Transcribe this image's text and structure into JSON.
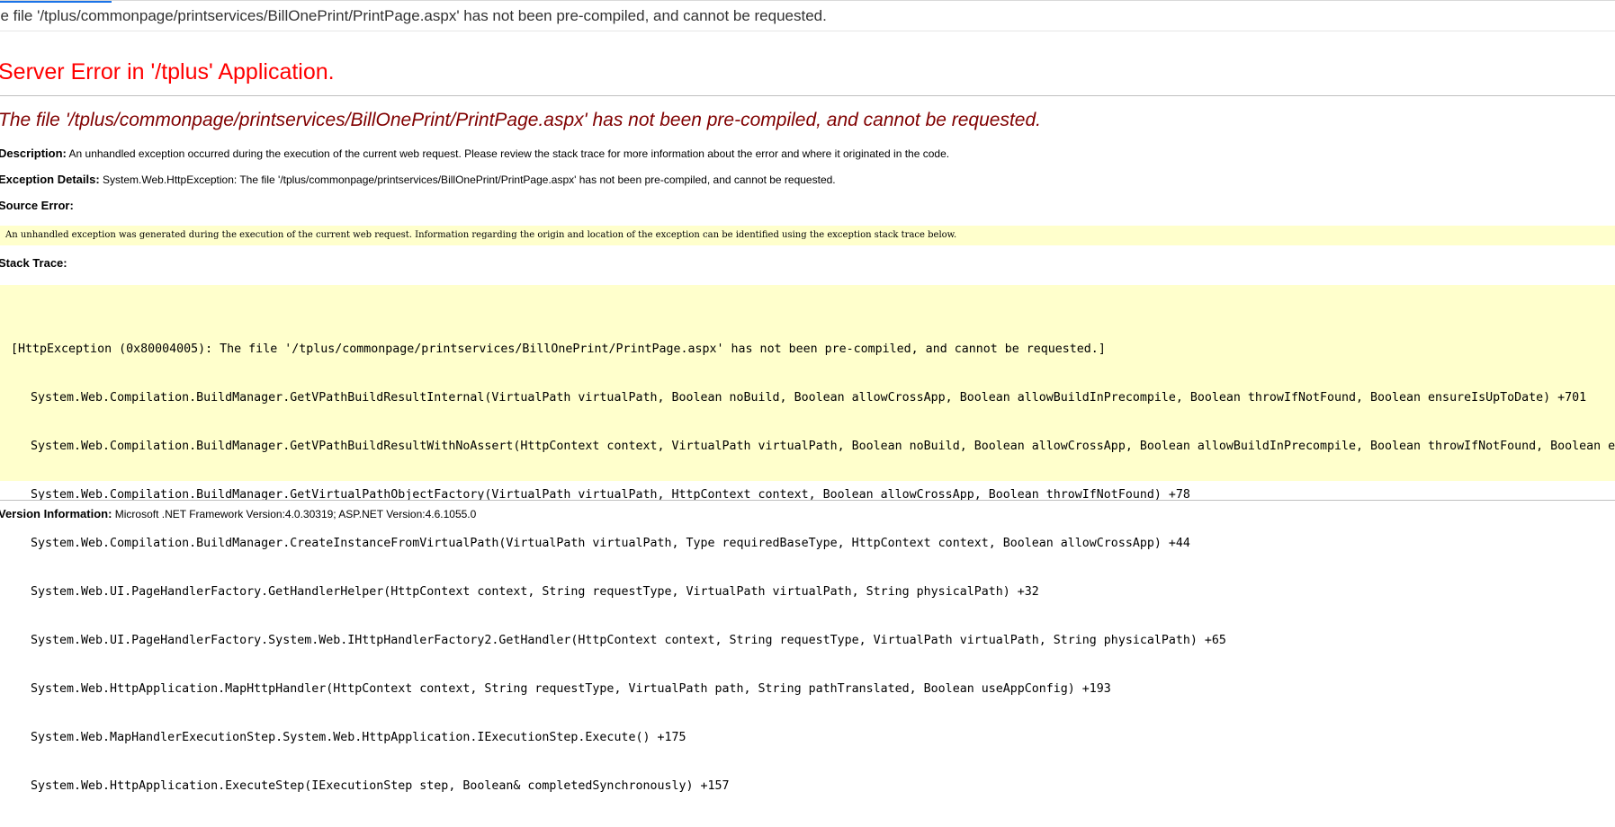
{
  "browser_tab": {
    "title": "he file '/tplus/commonpage/printservices/BillOnePrint/PrintPage.aspx' has not been pre-compiled, and cannot be requested."
  },
  "page": {
    "server_error_title": "Server Error in '/tplus' Application.",
    "error_heading": "The file '/tplus/commonpage/printservices/BillOnePrint/PrintPage.aspx' has not been pre-compiled, and cannot be requested.",
    "description_label": "Description:",
    "description_text": "An unhandled exception occurred during the execution of the current web request. Please review the stack trace for more information about the error and where it originated in the code.",
    "exception_label": "Exception Details:",
    "exception_text": "System.Web.HttpException: The file '/tplus/commonpage/printservices/BillOnePrint/PrintPage.aspx' has not been pre-compiled, and cannot be requested.",
    "source_label": "Source Error:",
    "source_text": "An unhandled exception was generated during the execution of the current web request. Information regarding the origin and location of the exception can be identified using the exception stack trace below.",
    "stack_label": "Stack Trace:",
    "stack_lines": [
      "[HttpException (0x80004005): The file '/tplus/commonpage/printservices/BillOnePrint/PrintPage.aspx' has not been pre-compiled, and cannot be requested.]",
      "System.Web.Compilation.BuildManager.GetVPathBuildResultInternal(VirtualPath virtualPath, Boolean noBuild, Boolean allowCrossApp, Boolean allowBuildInPrecompile, Boolean throwIfNotFound, Boolean ensureIsUpToDate) +701",
      "System.Web.Compilation.BuildManager.GetVPathBuildResultWithNoAssert(HttpContext context, VirtualPath virtualPath, Boolean noBuild, Boolean allowCrossApp, Boolean allowBuildInPrecompile, Boolean throwIfNotFound, Boolean e",
      "System.Web.Compilation.BuildManager.GetVirtualPathObjectFactory(VirtualPath virtualPath, HttpContext context, Boolean allowCrossApp, Boolean throwIfNotFound) +78",
      "System.Web.Compilation.BuildManager.CreateInstanceFromVirtualPath(VirtualPath virtualPath, Type requiredBaseType, HttpContext context, Boolean allowCrossApp) +44",
      "System.Web.UI.PageHandlerFactory.GetHandlerHelper(HttpContext context, String requestType, VirtualPath virtualPath, String physicalPath) +32",
      "System.Web.UI.PageHandlerFactory.System.Web.IHttpHandlerFactory2.GetHandler(HttpContext context, String requestType, VirtualPath virtualPath, String physicalPath) +65",
      "System.Web.HttpApplication.MapHttpHandler(HttpContext context, String requestType, VirtualPath path, String pathTranslated, Boolean useAppConfig) +193",
      "System.Web.MapHandlerExecutionStep.System.Web.HttpApplication.IExecutionStep.Execute() +175",
      "System.Web.HttpApplication.ExecuteStep(IExecutionStep step, Boolean& completedSynchronously) +157"
    ],
    "version_label": "Version Information:",
    "version_text": "Microsoft .NET Framework Version:4.0.30319; ASP.NET Version:4.6.1055.0"
  },
  "colors": {
    "server_error": "#ff0000",
    "error_heading": "#800000",
    "highlight_box": "#ffffcc",
    "tab_accent": "#1a73e8"
  }
}
